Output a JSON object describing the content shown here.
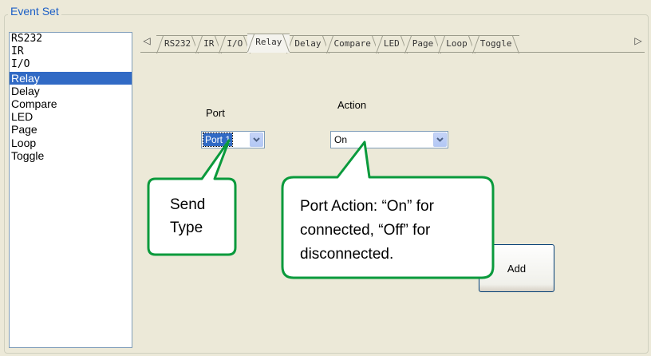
{
  "group": {
    "title": "Event Set"
  },
  "event_list": {
    "items": [
      "RS232",
      "IR",
      "I/O",
      "Relay",
      "Delay",
      "Compare",
      "LED",
      "Page",
      "Loop",
      "Toggle"
    ],
    "selected": "Relay"
  },
  "tabs": {
    "items": [
      "RS232",
      "IR",
      "I/O",
      "Relay",
      "Delay",
      "Compare",
      "LED",
      "Page",
      "Loop",
      "Toggle"
    ],
    "active": "Relay",
    "left_arrow": "◁",
    "right_arrow": "▷"
  },
  "relay_page": {
    "port_label": "Port",
    "port_value": "Port 1",
    "action_label": "Action",
    "action_value": "On",
    "add_label": "Add"
  },
  "callouts": {
    "send_type": [
      "Send",
      "Type"
    ],
    "port_action": [
      "Port Action: “On” for",
      "connected, “Off” for",
      "disconnected."
    ],
    "color": "#0a9a3c"
  },
  "colors": {
    "selection": "#316ac5",
    "group_title": "#1c5fc6",
    "background": "#ece9d8"
  }
}
